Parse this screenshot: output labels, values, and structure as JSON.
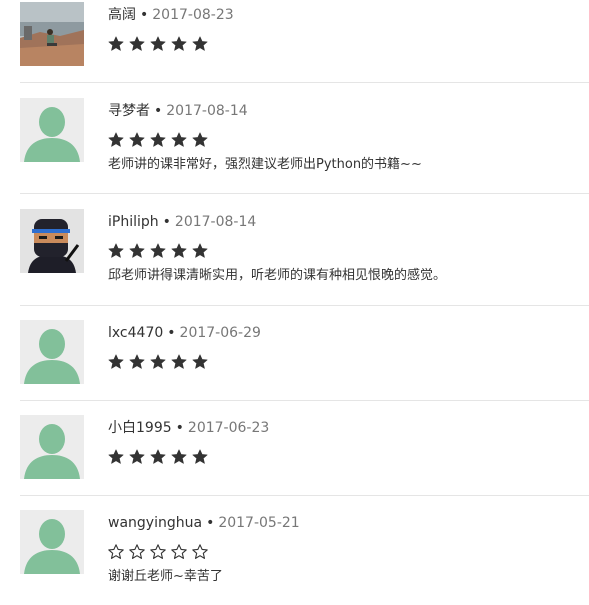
{
  "reviews": [
    {
      "author": "高阔",
      "date": "2017-08-23",
      "rating": 5,
      "comment": "",
      "avatar_icon": "landscape-photo-avatar"
    },
    {
      "author": "寻梦者",
      "date": "2017-08-14",
      "rating": 5,
      "comment": "老师讲的课非常好，强烈建议老师出Python的书籍~~",
      "avatar_icon": "default-user-avatar"
    },
    {
      "author": "iPhiliph",
      "date": "2017-08-14",
      "rating": 5,
      "comment": "邱老师讲得课清晰实用，听老师的课有种相见恨晚的感觉。",
      "avatar_icon": "ninja-avatar"
    },
    {
      "author": "lxc4470",
      "date": "2017-06-29",
      "rating": 5,
      "comment": "",
      "avatar_icon": "default-user-avatar"
    },
    {
      "author": "小白1995",
      "date": "2017-06-23",
      "rating": 5,
      "comment": "",
      "avatar_icon": "default-user-avatar"
    },
    {
      "author": "wangyinghua",
      "date": "2017-05-21",
      "rating": 0,
      "comment": "谢谢丘老师~幸苦了",
      "avatar_icon": "default-user-avatar"
    }
  ],
  "meta_separator": "•",
  "colors": {
    "default_avatar_bg": "#ececec",
    "default_avatar_fg": "#82c09a",
    "star": "#333333",
    "divider": "#e5e5e5"
  }
}
